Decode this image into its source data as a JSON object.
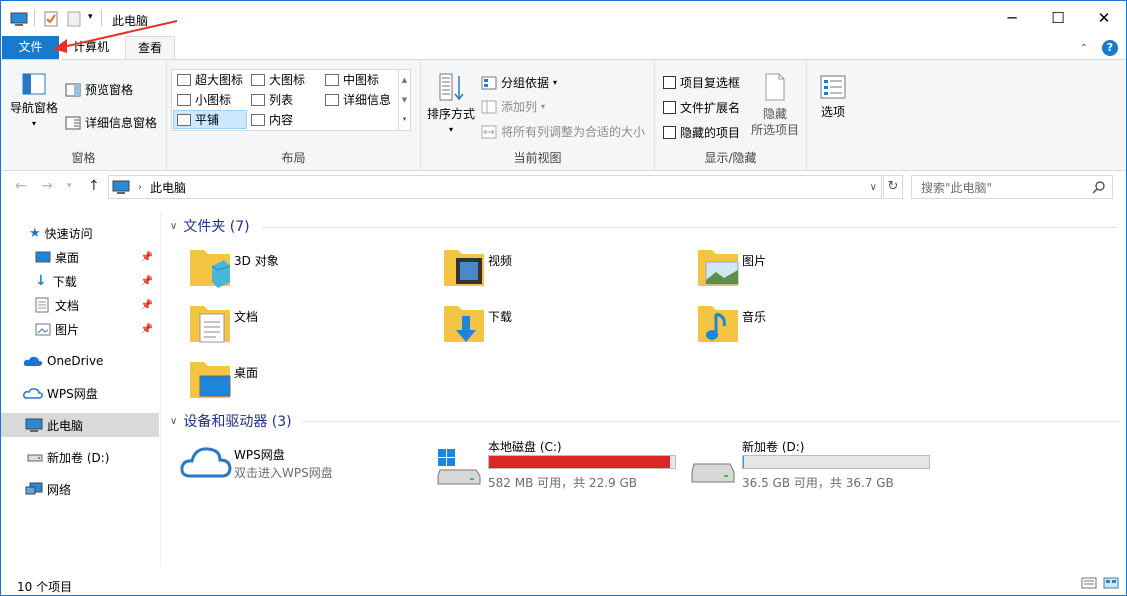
{
  "window": {
    "title": "此电脑",
    "minimize": "─",
    "maximize": "☐",
    "close": "✕"
  },
  "tabs": {
    "file": "文件",
    "computer": "计算机",
    "view": "查看",
    "help_icon": "?"
  },
  "ribbon": {
    "panes": {
      "nav_pane": "导航窗格",
      "preview_pane": "预览窗格",
      "details_pane": "详细信息窗格",
      "label": "窗格"
    },
    "layout": {
      "items": [
        "超大图标",
        "大图标",
        "中图标",
        "小图标",
        "列表",
        "详细信息",
        "平铺",
        "内容"
      ],
      "selected": "平铺",
      "label": "布局"
    },
    "current_view": {
      "sort_by": "排序方式",
      "group_by": "分组依据",
      "add_column": "添加列",
      "fit_columns": "将所有列调整为合适的大小",
      "label": "当前视图"
    },
    "show_hide": {
      "item_checkboxes": "项目复选框",
      "file_extensions": "文件扩展名",
      "hidden_items": "隐藏的项目",
      "hide_selected_line1": "隐藏",
      "hide_selected_line2": "所选项目",
      "label": "显示/隐藏"
    },
    "options": "选项"
  },
  "address": {
    "path": "此电脑",
    "search_placeholder": "搜索\"此电脑\""
  },
  "nav": {
    "quick_access": "快速访问",
    "desktop": "桌面",
    "downloads": "下载",
    "documents": "文档",
    "pictures": "图片",
    "onedrive": "OneDrive",
    "wps": "WPS网盘",
    "this_pc": "此电脑",
    "new_volume": "新加卷 (D:)",
    "network": "网络"
  },
  "content": {
    "folders_header": "文件夹 (7)",
    "folders": [
      "3D 对象",
      "视频",
      "图片",
      "文档",
      "下载",
      "音乐",
      "桌面"
    ],
    "devices_header": "设备和驱动器 (3)",
    "wps": {
      "name": "WPS网盘",
      "sub": "双击进入WPS网盘"
    },
    "drive_c": {
      "name": "本地磁盘 (C:)",
      "sub": "582 MB 可用，共 22.9 GB",
      "used_fraction": 0.975
    },
    "drive_d": {
      "name": "新加卷 (D:)",
      "sub": "36.5 GB 可用，共 36.7 GB",
      "used_fraction": 0.006
    }
  },
  "status": {
    "count": "10 个项目"
  },
  "colors": {
    "accent": "#1979ca",
    "drive_full": "#da2626",
    "drive_normal": "#26a0da",
    "annotation": "#e8302a"
  }
}
